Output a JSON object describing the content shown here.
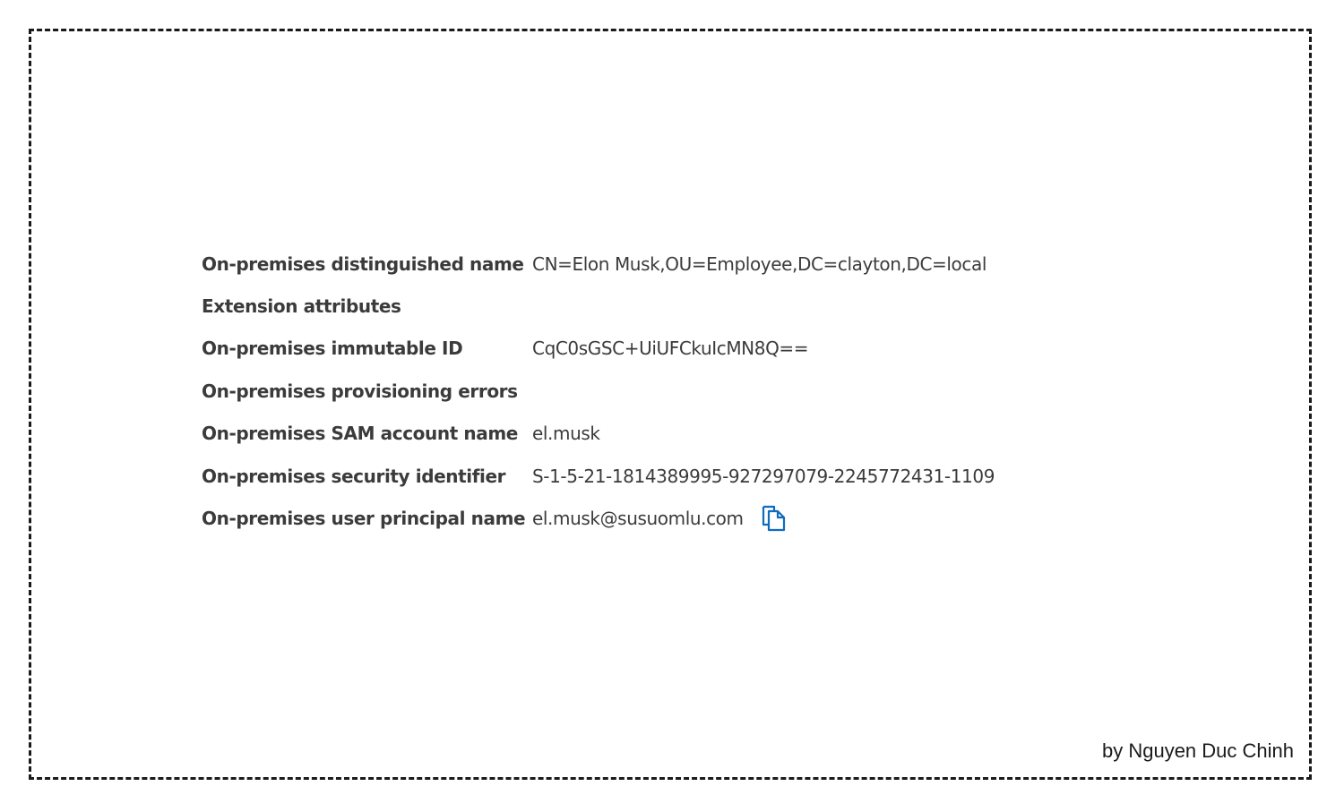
{
  "properties": [
    {
      "label": "On-premises distinguished name",
      "value": "CN=Elon Musk,OU=Employee,DC=clayton,DC=local"
    },
    {
      "label": "Extension attributes",
      "value": ""
    },
    {
      "label": "On-premises immutable ID",
      "value": "CqC0sGSC+UiUFCkuIcMN8Q=="
    },
    {
      "label": "On-premises provisioning errors",
      "value": ""
    },
    {
      "label": "On-premises SAM account name",
      "value": "el.musk"
    },
    {
      "label": "On-premises security identifier",
      "value": "S-1-5-21-1814389995-927297079-2245772431-1109"
    },
    {
      "label": "On-premises user principal name",
      "value": "el.musk@susuomlu.com",
      "icon": "copy-icon"
    }
  ],
  "credit": "by Nguyen Duc Chinh",
  "colors": {
    "text": "#3b3b3b",
    "accent": "#0f6cbd",
    "border": "#1a1a1a"
  }
}
